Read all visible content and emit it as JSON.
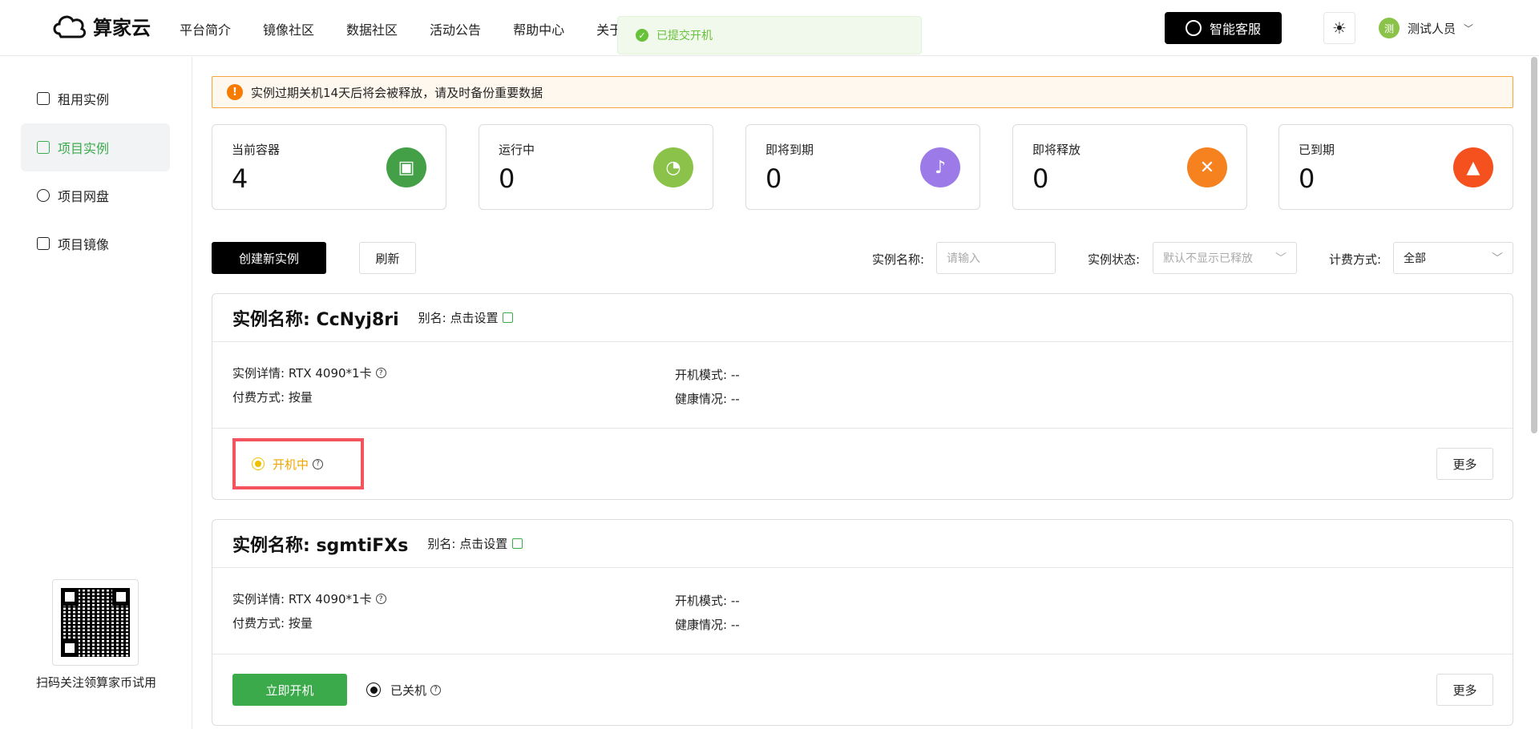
{
  "brand": {
    "name": "算家云"
  },
  "nav": [
    "平台简介",
    "镜像社区",
    "数据社区",
    "活动公告",
    "帮助中心",
    "关于"
  ],
  "toast": {
    "text": "已提交开机"
  },
  "header": {
    "support_label": "智能客服",
    "user_name": "测试人员",
    "avatar_char": "测"
  },
  "sidebar": {
    "items": [
      {
        "label": "租用实例",
        "icon": "cube-icon"
      },
      {
        "label": "项目实例",
        "icon": "layers-icon"
      },
      {
        "label": "项目网盘",
        "icon": "cloud-disk-icon"
      },
      {
        "label": "项目镜像",
        "icon": "image-icon"
      }
    ],
    "qr_caption": "扫码关注领算家币试用"
  },
  "notice": {
    "text": "实例过期关机14天后将会被释放，请及时备份重要数据"
  },
  "stats": [
    {
      "label": "当前容器",
      "value": "4",
      "color": "#43a047"
    },
    {
      "label": "运行中",
      "value": "0",
      "color": "#8bc34a"
    },
    {
      "label": "即将到期",
      "value": "0",
      "color": "#9c7be8"
    },
    {
      "label": "即将释放",
      "value": "0",
      "color": "#f5811f"
    },
    {
      "label": "已到期",
      "value": "0",
      "color": "#f4511e"
    }
  ],
  "toolbar": {
    "create_label": "创建新实例",
    "refresh_label": "刷新",
    "name_label": "实例名称:",
    "name_placeholder": "请输入",
    "status_label": "实例状态:",
    "status_placeholder": "默认不显示已释放",
    "billing_label": "计费方式:",
    "billing_value": "全部"
  },
  "instances": [
    {
      "title": "实例名称: CcNyj8ri",
      "alias": "别名: 点击设置",
      "details": "实例详情: RTX 4090*1卡",
      "billing": "付费方式:  按量",
      "boot_mode": "开机模式: --",
      "health": "健康情况: --",
      "status": "开机中",
      "more": "更多"
    },
    {
      "title": "实例名称: sgmtiFXs",
      "alias": "别名: 点击设置",
      "details": "实例详情: RTX 4090*1卡",
      "billing": "付费方式:  按量",
      "boot_mode": "开机模式: --",
      "health": "健康情况: --",
      "start_label": "立即开机",
      "status": "已关机",
      "more": "更多"
    }
  ]
}
